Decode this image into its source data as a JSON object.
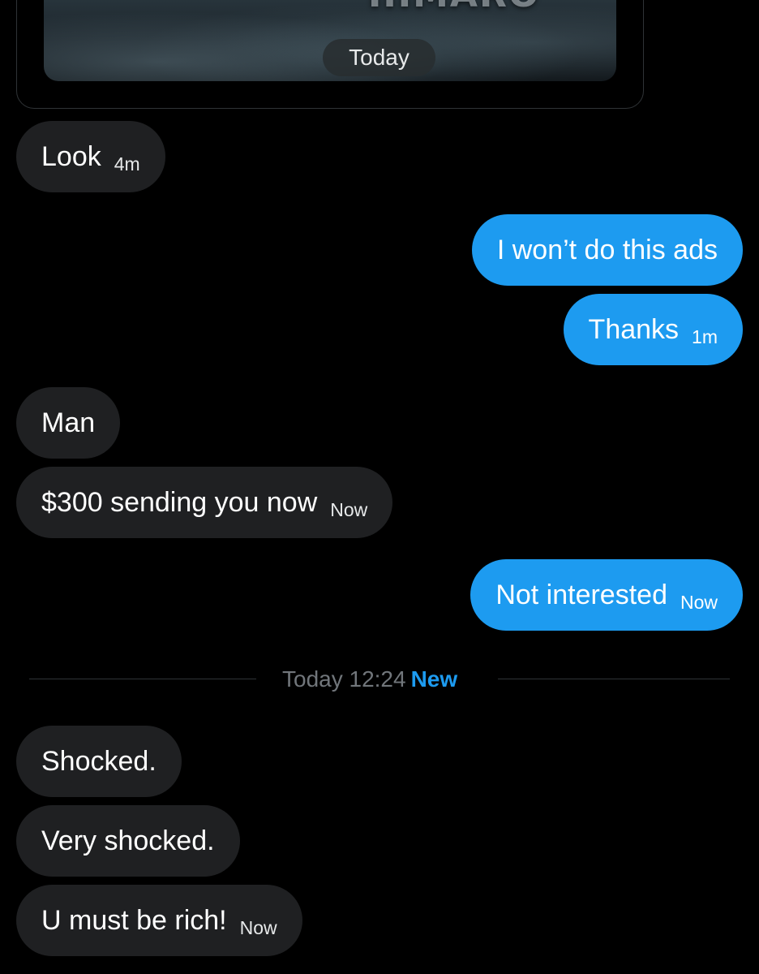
{
  "shared_post": {
    "media_title_fragment": "IIIMARO",
    "date_pill": "Today"
  },
  "messages": [
    {
      "direction": "in",
      "text": "Look",
      "time": "4m"
    },
    {
      "direction": "out",
      "text": "I won’t do this ads",
      "time": ""
    },
    {
      "direction": "out",
      "text": "Thanks",
      "time": "1m"
    },
    {
      "direction": "in",
      "text": "Man",
      "time": ""
    },
    {
      "direction": "in",
      "text": "$300 sending you now",
      "time": "Now"
    },
    {
      "direction": "out",
      "text": "Not interested",
      "time": "Now"
    },
    {
      "direction": "in",
      "text": "Shocked.",
      "time": ""
    },
    {
      "direction": "in",
      "text": "Very shocked.",
      "time": ""
    },
    {
      "direction": "in",
      "text": "U must be rich!",
      "time": "Now"
    }
  ],
  "divider": {
    "date": "Today 12:24",
    "new_label": "New"
  },
  "colors": {
    "background": "#000000",
    "incoming_bubble": "#1f2022",
    "outgoing_bubble": "#1d9bf0",
    "accent": "#1d9bf0",
    "muted_text": "#71767b"
  }
}
